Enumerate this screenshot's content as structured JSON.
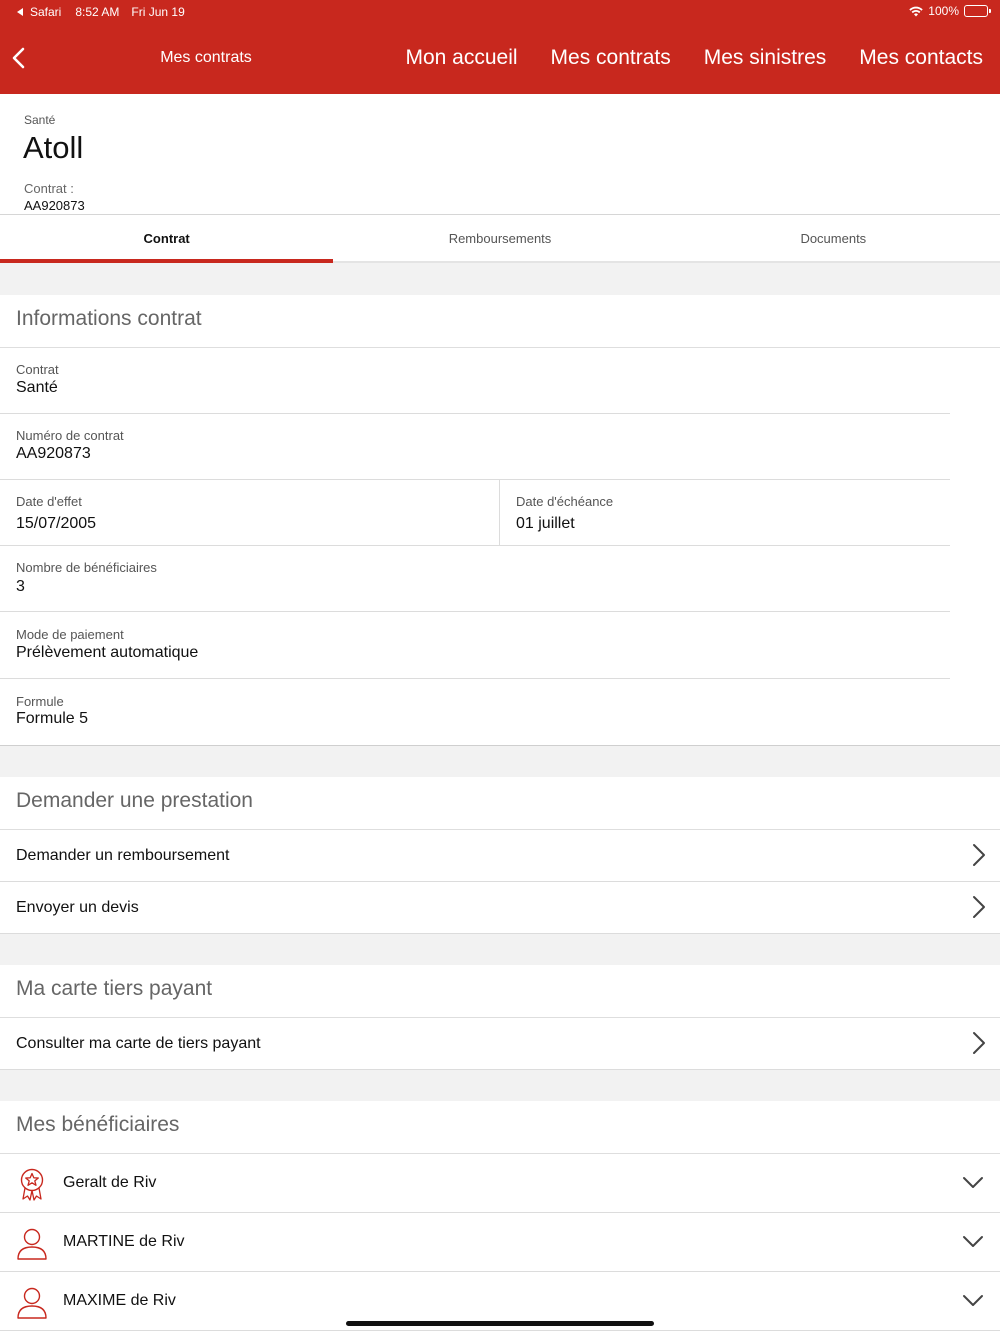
{
  "status_bar": {
    "back_app": "Safari",
    "time": "8:52 AM",
    "date": "Fri Jun 19",
    "battery": "100%"
  },
  "header": {
    "title": "Mes contrats",
    "nav": [
      "Mon accueil",
      "Mes contrats",
      "Mes sinistres",
      "Mes contacts"
    ]
  },
  "contract": {
    "category": "Santé",
    "name": "Atoll",
    "number_label": "Contrat :",
    "number": "AA920873"
  },
  "tabs": [
    "Contrat",
    "Remboursements",
    "Documents"
  ],
  "info": {
    "title": "Informations contrat",
    "contrat_label": "Contrat",
    "contrat_value": "Santé",
    "numero_label": "Numéro de contrat",
    "numero_value": "AA920873",
    "effet_label": "Date d'effet",
    "effet_value": "15/07/2005",
    "echeance_label": "Date d'échéance",
    "echeance_value": "01 juillet",
    "benef_label": "Nombre de bénéficiaires",
    "benef_value": "3",
    "paiement_label": "Mode de paiement",
    "paiement_value": "Prélèvement automatique",
    "formule_label": "Formule",
    "formule_value": "Formule 5"
  },
  "prestation": {
    "title": "Demander une prestation",
    "items": [
      "Demander un remboursement",
      "Envoyer un devis"
    ]
  },
  "tiers_payant": {
    "title": "Ma carte tiers payant",
    "item": "Consulter ma carte de tiers payant"
  },
  "beneficiaires": {
    "title": "Mes bénéficiaires",
    "items": [
      {
        "name": "Geralt de Riv",
        "icon": "award-icon"
      },
      {
        "name": "MARTINE de Riv",
        "icon": "user-icon"
      },
      {
        "name": "MAXIME de Riv",
        "icon": "user-icon"
      }
    ]
  },
  "colors": {
    "brand_red": "#c8281e",
    "background_gray": "#f2f2f2"
  }
}
